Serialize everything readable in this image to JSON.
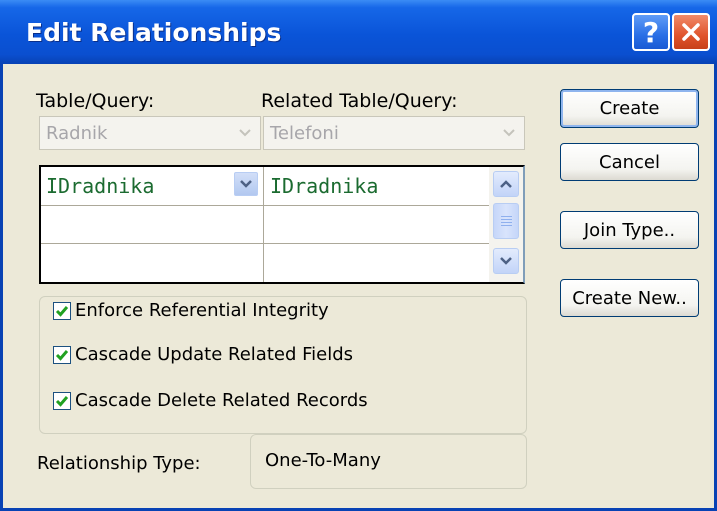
{
  "window": {
    "title": "Edit Relationships",
    "help_label": "?"
  },
  "labels": {
    "table_query": "Table/Query:",
    "related_table_query": "Related Table/Query:",
    "relationship_type": "Relationship Type:"
  },
  "combos": {
    "table": {
      "value": "Radnik",
      "disabled": true
    },
    "related_table": {
      "value": "Telefoni",
      "disabled": true
    }
  },
  "fields_grid": {
    "rows": [
      {
        "left": "IDradnika",
        "right": "IDradnika"
      },
      {
        "left": "",
        "right": ""
      },
      {
        "left": "",
        "right": ""
      }
    ]
  },
  "buttons": {
    "create": "Create",
    "cancel": "Cancel",
    "join_type": "Join Type..",
    "create_new": "Create New.."
  },
  "options": {
    "enforce_integrity": {
      "label": "Enforce Referential Integrity",
      "checked": true
    },
    "cascade_update": {
      "label": "Cascade Update Related Fields",
      "checked": true
    },
    "cascade_delete": {
      "label": "Cascade Delete Related Records",
      "checked": true
    }
  },
  "relationship_type_value": "One-To-Many",
  "icons": {
    "help": "help-icon",
    "close": "close-icon",
    "dropdown": "chevron-down-icon",
    "scroll_up": "scroll-up-icon",
    "scroll_down": "scroll-down-icon",
    "check": "checkmark-icon"
  },
  "colors": {
    "titlebar": "#0a54d8",
    "dialog_bg": "#ece9d8",
    "close_button": "#e0542c",
    "field_text": "#1b6b30",
    "button_border": "#003c74",
    "checkmark": "#21a121"
  }
}
